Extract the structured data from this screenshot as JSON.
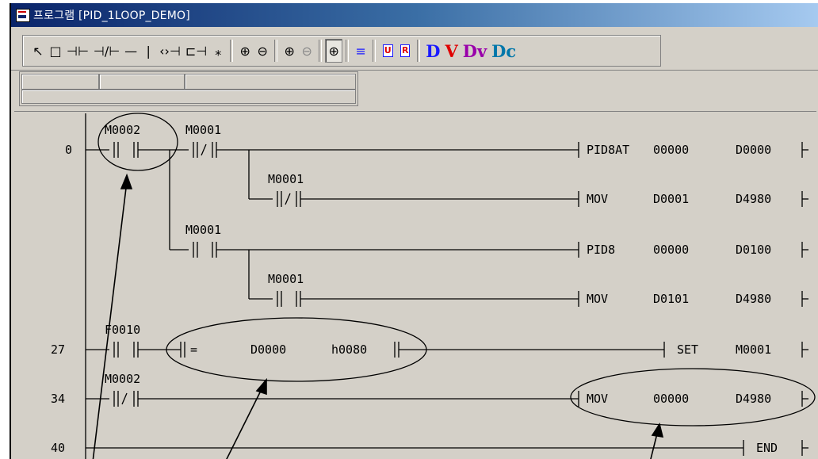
{
  "window": {
    "title": "프로그램 [PID_1LOOP_DEMO]"
  },
  "toolbar": {
    "buttons": [
      {
        "name": "select-pointer-icon",
        "glyph": "↖"
      },
      {
        "name": "box-icon",
        "glyph": "□"
      },
      {
        "name": "contact-no-icon",
        "glyph": "⊣⊢"
      },
      {
        "name": "contact-nc-icon",
        "glyph": "⊣/⊢"
      },
      {
        "name": "horizontal-line-icon",
        "glyph": "—"
      },
      {
        "name": "vertical-line-icon",
        "glyph": "|"
      },
      {
        "name": "coil-icon",
        "glyph": "‹›⊣"
      },
      {
        "name": "function-box-icon",
        "glyph": "⊏⊣"
      },
      {
        "name": "special-icon",
        "glyph": "⁎"
      }
    ],
    "zoom_buttons": [
      {
        "name": "zoom-in-icon",
        "glyph": "⊕"
      },
      {
        "name": "zoom-out-icon",
        "glyph": "⊖"
      }
    ],
    "zoom2_buttons": [
      {
        "name": "zoom-in-small-icon",
        "glyph": "⊕"
      },
      {
        "name": "zoom-out-small-icon",
        "glyph": "⊖"
      }
    ],
    "zoom_fit": {
      "name": "zoom-fit-icon",
      "glyph": "⊕"
    },
    "align": {
      "name": "align-lines-icon",
      "glyph": "≡"
    },
    "u_button": "U",
    "r_button": "R",
    "d_button": "D",
    "v_button": "V",
    "dv_button": "Dv",
    "dc_button": "Dc",
    "colors": {
      "d": "#1a1aff",
      "v": "#e00000",
      "dv": "#9900aa",
      "dc": "#0077aa"
    }
  },
  "ladder": {
    "line_numbers": [
      "0",
      "27",
      "34",
      "40"
    ],
    "contacts": [
      {
        "label": "M0002",
        "type": "NO"
      },
      {
        "label": "M0001",
        "type": "NC"
      },
      {
        "label": "M0001",
        "type": "NC"
      },
      {
        "label": "M0001",
        "type": "NO"
      },
      {
        "label": "M0001",
        "type": "NO"
      },
      {
        "label": "F0010",
        "type": "NO"
      },
      {
        "label": "M0002",
        "type": "NC"
      }
    ],
    "compare": {
      "op": "=",
      "a": "D0000",
      "b": "h0080"
    },
    "instructions": [
      {
        "op": "PID8AT",
        "a": "00000",
        "b": "D0000"
      },
      {
        "op": "MOV",
        "a": "D0001",
        "b": "D4980"
      },
      {
        "op": "PID8",
        "a": "00000",
        "b": "D0100"
      },
      {
        "op": "MOV",
        "a": "D0101",
        "b": "D4980"
      },
      {
        "op": "SET",
        "a": "M0001",
        "b": ""
      },
      {
        "op": "MOV",
        "a": "00000",
        "b": "D4980"
      },
      {
        "op": "END",
        "a": "",
        "b": ""
      }
    ]
  }
}
